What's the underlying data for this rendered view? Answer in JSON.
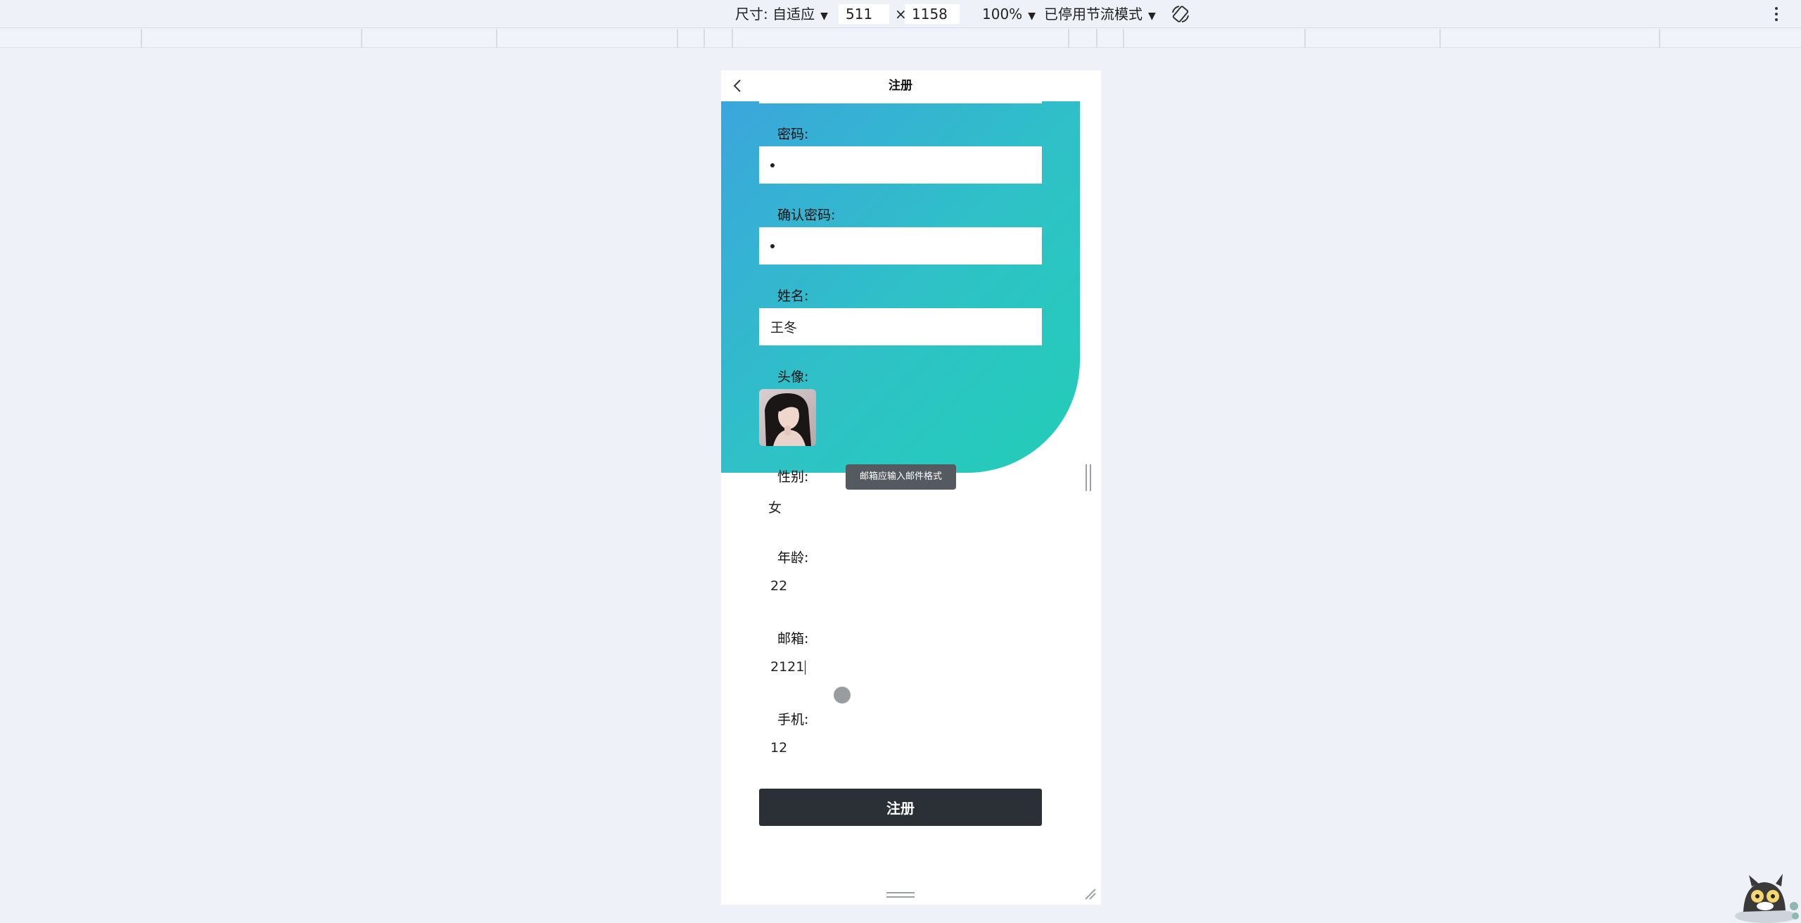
{
  "devtools": {
    "size_label": "尺寸: 自适应",
    "width_value": "511",
    "times": "×",
    "height_value": "1158",
    "zoom": "100%",
    "throttle": "已停用节流模式"
  },
  "page": {
    "title": "注册",
    "fields": {
      "password_label": "密码:",
      "confirm_label": "确认密码:",
      "name_label": "姓名:",
      "name_value": "王冬",
      "avatar_label": "头像:",
      "gender_label": "性别:",
      "gender_value": "女",
      "age_label": "年龄:",
      "age_value": "22",
      "email_label": "邮箱:",
      "email_value": "2121",
      "phone_label": "手机:",
      "phone_value": "12"
    },
    "tooltip": "邮箱应输入邮件格式",
    "submit_label": "注册"
  },
  "colors": {
    "gradient_start": "#3ba6dc",
    "gradient_end": "#22cdb7",
    "button_bg": "#2b2f36",
    "tooltip_bg": "#555a60"
  }
}
